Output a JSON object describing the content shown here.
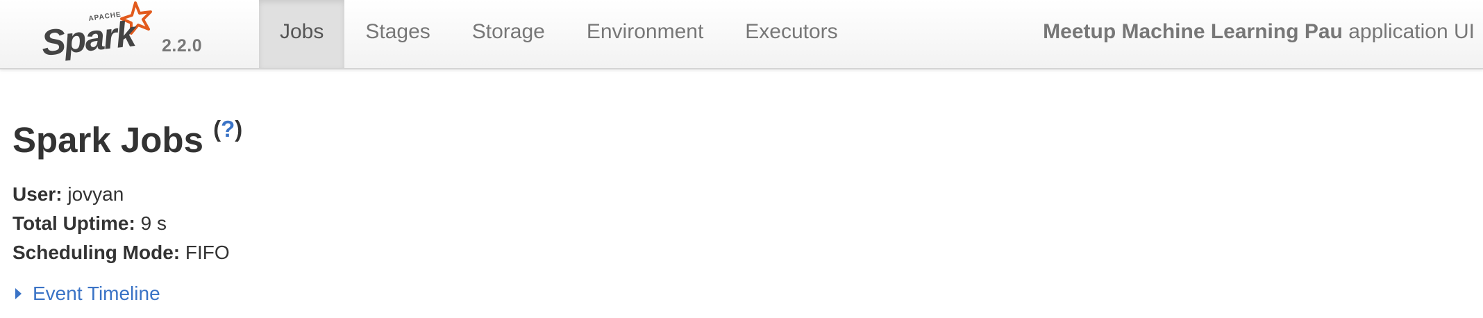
{
  "navbar": {
    "logo": {
      "apache_text": "APACHE",
      "name": "Spark",
      "version": "2.2.0",
      "star_color": "#e25a1c",
      "icon": "spark-star-logo"
    },
    "tabs": [
      {
        "label": "Jobs",
        "active": true
      },
      {
        "label": "Stages",
        "active": false
      },
      {
        "label": "Storage",
        "active": false
      },
      {
        "label": "Environment",
        "active": false
      },
      {
        "label": "Executors",
        "active": false
      }
    ],
    "app_name": "Meetup Machine Learning Pau",
    "app_suffix": "application UI"
  },
  "page": {
    "title": "Spark Jobs",
    "help_paren_open": "(",
    "help_link": "?",
    "help_paren_close": ")"
  },
  "summary": {
    "user_label": "User:",
    "user_value": "jovyan",
    "uptime_label": "Total Uptime:",
    "uptime_value": "9 s",
    "scheduling_label": "Scheduling Mode:",
    "scheduling_value": "FIFO"
  },
  "event_timeline": {
    "label": "Event Timeline",
    "expanded": false
  },
  "colors": {
    "link": "#3a73c6",
    "active_tab_bg": "#e0e0e0",
    "text": "#333333",
    "nav_text": "#777777"
  }
}
